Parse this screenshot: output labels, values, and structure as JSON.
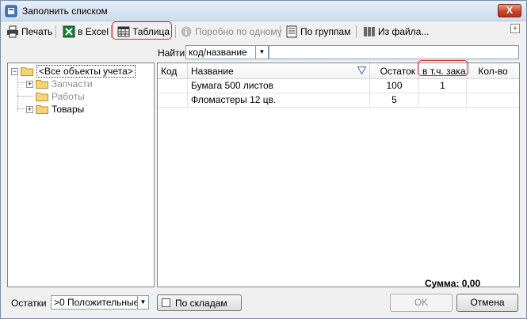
{
  "window": {
    "title": "Заполнить списком",
    "close_label": "X"
  },
  "toolbar": {
    "print": "Печать",
    "excel": "в Excel",
    "table": "Таблица",
    "one_by_one": "Поробно по одному",
    "by_groups": "По группам",
    "from_file": "Из файла..."
  },
  "find": {
    "label": "Найти",
    "mode": "код/название",
    "value": ""
  },
  "tree": {
    "root": "<Все объекты учета>",
    "children": [
      "Запчасти",
      "Работы",
      "Товары"
    ]
  },
  "grid": {
    "columns": [
      "Код",
      "Название",
      "Остаток",
      "в т.ч. зака",
      "Кол-во"
    ],
    "rows": [
      {
        "code": "",
        "name": "Бумага 500 листов",
        "rest": "100",
        "reserved": "1",
        "qty": ""
      },
      {
        "code": "",
        "name": "Фломастеры 12 цв.",
        "rest": "5",
        "reserved": "",
        "qty": ""
      }
    ]
  },
  "footer": {
    "sum": "Сумма: 0,00",
    "rest_label": "Остатки",
    "rest_filter": ">0  Положительные",
    "by_warehouses": "По складам",
    "ok": "OK",
    "cancel": "Отмена"
  },
  "colors": {
    "highlight": "#d6262c",
    "titlebar": "#cfdcec",
    "close": "#c9442c"
  }
}
